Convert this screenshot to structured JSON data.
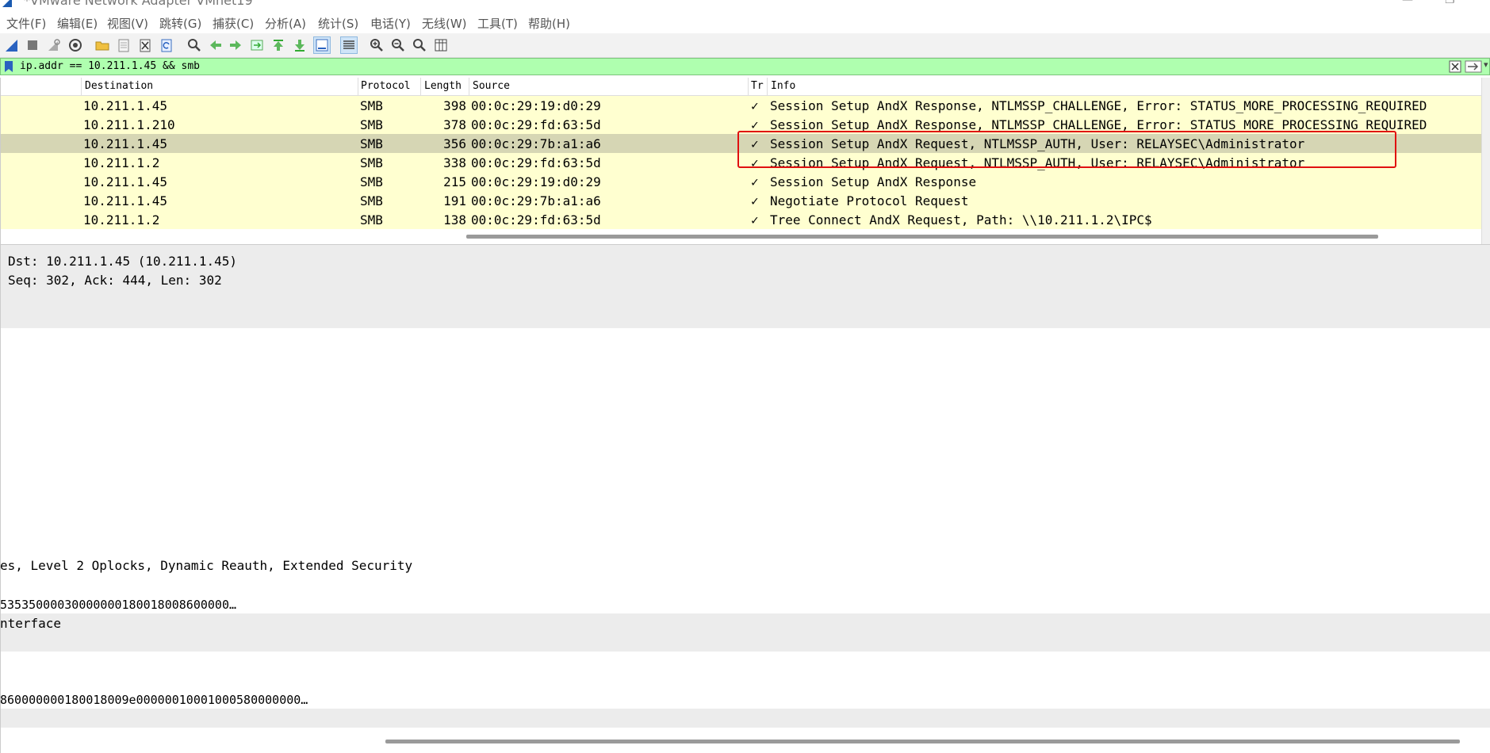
{
  "window": {
    "title": "*VMware Network Adapter VMnet19"
  },
  "menu": [
    "文件(F)",
    "编辑(E)",
    "视图(V)",
    "跳转(G)",
    "捕获(C)",
    "分析(A)",
    "统计(S)",
    "电话(Y)",
    "无线(W)",
    "工具(T)",
    "帮助(H)"
  ],
  "toolbar_icons": [
    "shark-fin-start-icon",
    "stop-capture-icon",
    "restart-capture-icon",
    "capture-options-icon",
    "open-file-icon",
    "save-file-icon",
    "close-file-icon",
    "reload-file-icon",
    "find-packet-icon",
    "go-back-icon",
    "go-forward-icon",
    "go-to-packet-icon",
    "go-first-icon",
    "go-last-icon",
    "autoscroll-icon",
    "colorize-icon",
    "zoom-in-icon",
    "zoom-out-icon",
    "zoom-normal-icon",
    "resize-columns-icon"
  ],
  "filter": {
    "text": "ip.addr == 10.211.1.45 && smb"
  },
  "columns": {
    "destination": "Destination",
    "protocol": "Protocol",
    "length": "Length",
    "source": "Source",
    "tr": "Tr",
    "info": "Info"
  },
  "packets": [
    {
      "destination": "10.211.1.45",
      "protocol": "SMB",
      "length": "398",
      "source": "00:0c:29:19:d0:29",
      "tr": "✓",
      "info": "Session Setup AndX Response, NTLMSSP_CHALLENGE, Error: STATUS_MORE_PROCESSING_REQUIRED"
    },
    {
      "destination": "10.211.1.210",
      "protocol": "SMB",
      "length": "378",
      "source": "00:0c:29:fd:63:5d",
      "tr": "✓",
      "info": "Session Setup AndX Response, NTLMSSP_CHALLENGE, Error: STATUS_MORE_PROCESSING_REQUIRED"
    },
    {
      "destination": "10.211.1.45",
      "protocol": "SMB",
      "length": "356",
      "source": "00:0c:29:7b:a1:a6",
      "tr": "✓",
      "info": "Session Setup AndX Request, NTLMSSP_AUTH, User: RELAYSEC\\Administrator",
      "selected": true
    },
    {
      "destination": "10.211.1.2",
      "protocol": "SMB",
      "length": "338",
      "source": "00:0c:29:fd:63:5d",
      "tr": "✓",
      "info": "Session Setup AndX Request, NTLMSSP_AUTH, User: RELAYSEC\\Administrator"
    },
    {
      "destination": "10.211.1.45",
      "protocol": "SMB",
      "length": "215",
      "source": "00:0c:29:19:d0:29",
      "tr": "✓",
      "info": "Session Setup AndX Response"
    },
    {
      "destination": "10.211.1.45",
      "protocol": "SMB",
      "length": "191",
      "source": "00:0c:29:7b:a1:a6",
      "tr": "✓",
      "info": "Negotiate Protocol Request"
    },
    {
      "destination": "10.211.1.2",
      "protocol": "SMB",
      "length": "138",
      "source": "00:0c:29:fd:63:5d",
      "tr": "✓",
      "info": "Tree Connect AndX Request, Path: \\\\10.211.1.2\\IPC$"
    }
  ],
  "details": {
    "dst": "Dst: 10.211.1.45 (10.211.1.45)",
    "seq": "Seq: 302, Ack: 444, Len: 302",
    "capabilities": "es, Level 2 Oplocks, Dynamic Reauth, Extended Security",
    "hex1": "53535000030000000180018008600000…",
    "interface": "nterface",
    "hex2": "860000000180018009e00000010001000580000000…"
  },
  "colors": {
    "filter_bg": "#afffaf",
    "row_bg": "#ffffd0",
    "selected_bg": "#d6d6b4",
    "highlight_box": "#e01010"
  }
}
